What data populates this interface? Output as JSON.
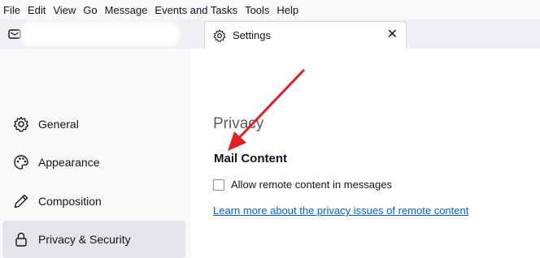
{
  "menubar": {
    "items": [
      "File",
      "Edit",
      "View",
      "Go",
      "Message",
      "Events and Tasks",
      "Tools",
      "Help"
    ]
  },
  "tabs": {
    "settings_tab_label": "Settings",
    "close_glyph": "✕"
  },
  "sidebar": {
    "categories": [
      {
        "label": "General",
        "icon": "gear-icon"
      },
      {
        "label": "Appearance",
        "icon": "palette-icon"
      },
      {
        "label": "Composition",
        "icon": "pencil-icon"
      },
      {
        "label": "Privacy & Security",
        "icon": "lock-icon",
        "selected": true
      }
    ]
  },
  "content": {
    "section_title": "Privacy",
    "mail_content_heading": "Mail Content",
    "remote_content_label": "Allow remote content in messages",
    "remote_content_checked": false,
    "learn_more_link": "Learn more about the privacy issues of remote content"
  },
  "annotation": {
    "arrow_color": "#e02020"
  }
}
